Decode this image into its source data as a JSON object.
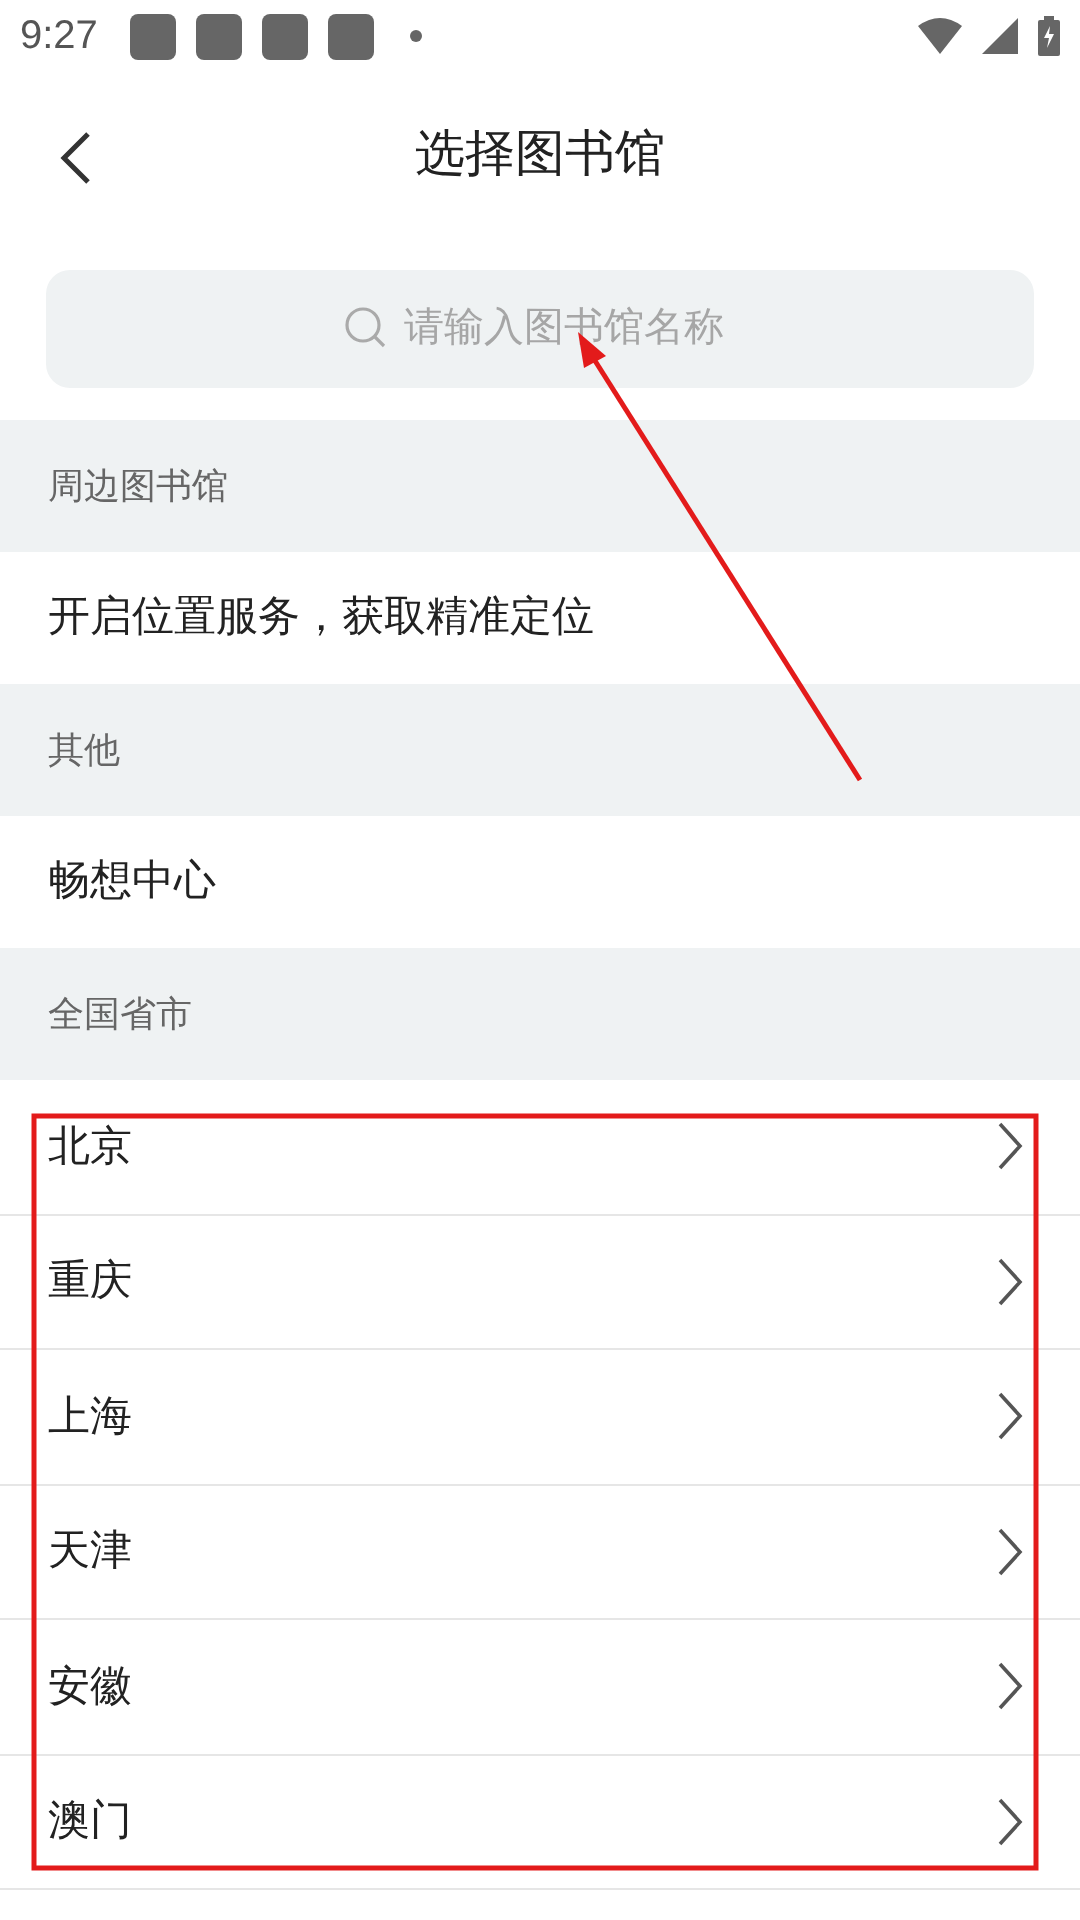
{
  "status_bar": {
    "time": "9:27"
  },
  "header": {
    "title": "选择图书馆"
  },
  "search": {
    "placeholder": "请输入图书馆名称"
  },
  "sections": [
    {
      "title": "周边图书馆",
      "items": [
        {
          "label": "开启位置服务，获取精准定位",
          "kind": "plain"
        }
      ]
    },
    {
      "title": "其他",
      "items": [
        {
          "label": "畅想中心",
          "kind": "plain"
        }
      ]
    },
    {
      "title": "全国省市",
      "items": [
        {
          "label": "北京",
          "kind": "nav"
        },
        {
          "label": "重庆",
          "kind": "nav"
        },
        {
          "label": "上海",
          "kind": "nav"
        },
        {
          "label": "天津",
          "kind": "nav"
        },
        {
          "label": "安徽",
          "kind": "nav"
        },
        {
          "label": "澳门",
          "kind": "nav"
        }
      ]
    }
  ],
  "annotations": {
    "arrow_shown": true,
    "highlight_box_shown": true
  }
}
